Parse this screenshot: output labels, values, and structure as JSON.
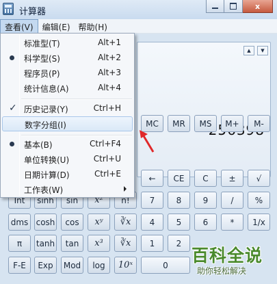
{
  "window": {
    "title": "计算器",
    "controls": {
      "minimize": "minimize-icon",
      "maximize": "maximize-icon",
      "close": "x"
    }
  },
  "menubar": {
    "items": [
      {
        "label": "查看(V)",
        "active": true
      },
      {
        "label": "编辑(E)"
      },
      {
        "label": "帮助(H)"
      }
    ]
  },
  "view_menu": {
    "items": [
      {
        "label": "标准型(T)",
        "accel": "Alt+1"
      },
      {
        "label": "科学型(S)",
        "accel": "Alt+2",
        "mark": "radio"
      },
      {
        "label": "程序员(P)",
        "accel": "Alt+3"
      },
      {
        "label": "统计信息(A)",
        "accel": "Alt+4"
      },
      {
        "label": "历史记录(Y)",
        "accel": "Ctrl+H",
        "mark": "check"
      },
      {
        "label": "数字分组(I)",
        "accel": "",
        "highlighted": true
      },
      {
        "label": "基本(B)",
        "accel": "Ctrl+F4",
        "mark": "radio"
      },
      {
        "label": "单位转换(U)",
        "accel": "Ctrl+U"
      },
      {
        "label": "日期计算(D)",
        "accel": "Ctrl+E"
      },
      {
        "label": "工作表(W)",
        "accel": "",
        "submenu": true
      }
    ]
  },
  "display": {
    "value": "256398",
    "dropdown_icons": [
      "chevron-up-icon",
      "chevron-down-icon"
    ]
  },
  "keys": {
    "row1": [
      "MC",
      "MR",
      "MS",
      "M+",
      "M-"
    ],
    "row2": [
      "←",
      "CE",
      "C",
      "±",
      "√"
    ],
    "row3": [
      "Int",
      "sinh",
      "sin",
      "x²",
      "n!",
      "7",
      "8",
      "9",
      "/",
      "%"
    ],
    "row4": [
      "dms",
      "cosh",
      "cos",
      "xʸ",
      "∛x",
      "4",
      "5",
      "6",
      "*",
      "1/x"
    ],
    "row5": [
      "π",
      "tanh",
      "tan",
      "x³",
      "∛x",
      "1",
      "2"
    ],
    "row6": [
      "F-E",
      "Exp",
      "Mod",
      "log",
      "10ˣ",
      "0"
    ]
  },
  "watermark": {
    "title": "百科全说",
    "subtitle": "助你轻松解决"
  },
  "colors": {
    "accent_pointer": "#e0282a",
    "watermark_green": "#4a8a2d"
  }
}
